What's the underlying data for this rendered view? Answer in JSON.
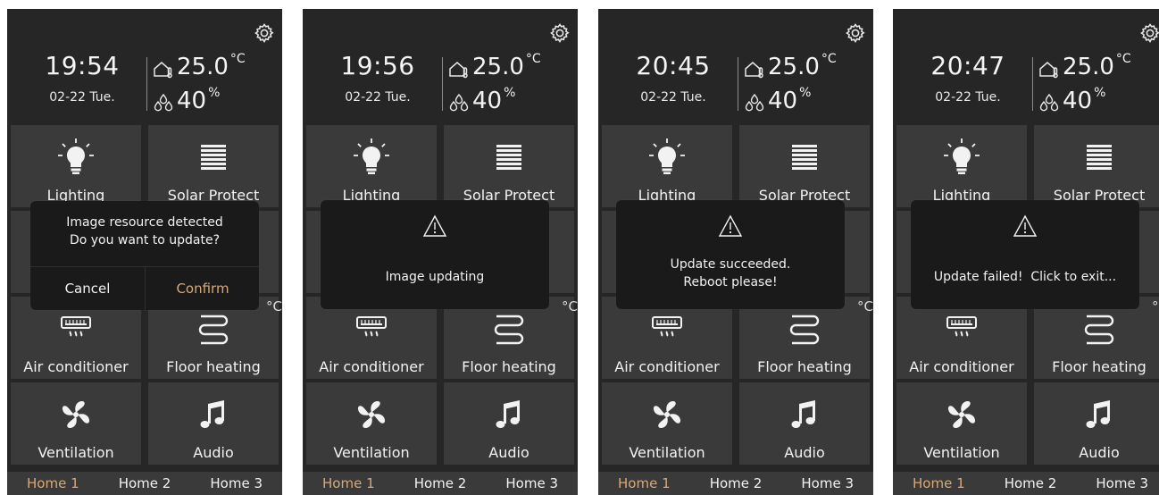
{
  "colors": {
    "panel_bg": "#262626",
    "tile_bg": "#3a3a3a",
    "accent": "#d7a978",
    "dialog_bg": "#1a1a1a"
  },
  "icons": {
    "settings": "gear-icon",
    "temperature": "house-thermometer-icon",
    "humidity": "water-drops-icon",
    "lighting": "lightbulb-icon",
    "solar_protect": "blinds-icon",
    "air_conditioner": "air-conditioner-icon",
    "floor_heating": "floor-heating-icon",
    "ventilation": "fan-icon",
    "audio": "music-note-icon",
    "warning": "warning-triangle-icon"
  },
  "panels": [
    {
      "time": "19:54",
      "date": "02-22 Tue.",
      "temperature": "25.0",
      "temperature_unit": "°C",
      "humidity": "40",
      "humidity_unit": "%",
      "tiles": {
        "lighting": "Lighting",
        "solar_protect": "Solar Protect",
        "air_conditioner": "Air conditioner",
        "floor_heating": "Floor heating",
        "ventilation": "Ventilation",
        "audio": "Audio"
      },
      "temp_tail": "°C",
      "nav": [
        "Home 1",
        "Home 2",
        "Home 3"
      ],
      "dialog": {
        "line1": "Image resource detected",
        "line2": "Do you want to update?",
        "cancel": "Cancel",
        "confirm": "Confirm"
      }
    },
    {
      "time": "19:56",
      "date": "02-22 Tue.",
      "temperature": "25.0",
      "temperature_unit": "°C",
      "humidity": "40",
      "humidity_unit": "%",
      "tiles": {
        "lighting": "Lighting",
        "solar_protect": "Solar Protect",
        "air_conditioner": "Air conditioner",
        "floor_heating": "Floor heating",
        "ventilation": "Ventilation",
        "audio": "Audio"
      },
      "temp_tail": "°C",
      "nav": [
        "Home 1",
        "Home 2",
        "Home 3"
      ],
      "dialog": {
        "message": "Image updating"
      }
    },
    {
      "time": "20:45",
      "date": "02-22 Tue.",
      "temperature": "25.0",
      "temperature_unit": "°C",
      "humidity": "40",
      "humidity_unit": "%",
      "tiles": {
        "lighting": "Lighting",
        "solar_protect": "Solar Protect",
        "air_conditioner": "Air conditioner",
        "floor_heating": "Floor heating",
        "ventilation": "Ventilation",
        "audio": "Audio"
      },
      "temp_tail": "°C",
      "nav": [
        "Home 1",
        "Home 2",
        "Home 3"
      ],
      "dialog": {
        "line1": "Update succeeded.",
        "line2": "Reboot please!"
      }
    },
    {
      "time": "20:47",
      "date": "02-22 Tue.",
      "temperature": "25.0",
      "temperature_unit": "°C",
      "humidity": "40",
      "humidity_unit": "%",
      "tiles": {
        "lighting": "Lighting",
        "solar_protect": "Solar Protect",
        "air_conditioner": "Air conditioner",
        "floor_heating": "Floor heating",
        "ventilation": "Ventilation",
        "audio": "Audio"
      },
      "temp_tail": "°C",
      "nav": [
        "Home 1",
        "Home 2",
        "Home 3"
      ],
      "dialog": {
        "message": "Update failed!  Click to exit..."
      }
    }
  ]
}
